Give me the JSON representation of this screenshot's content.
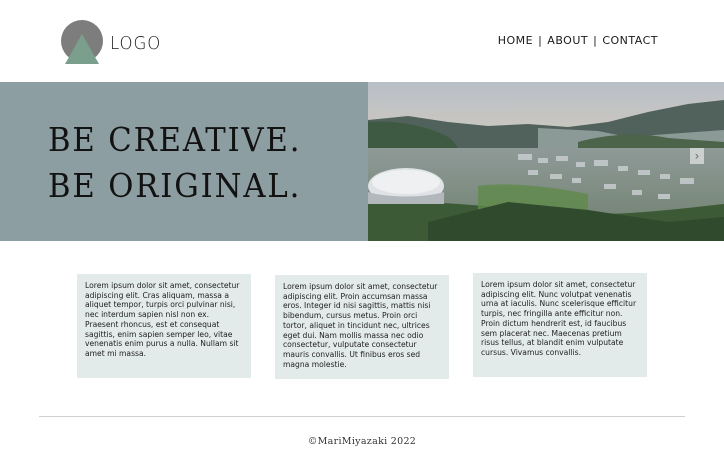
{
  "header": {
    "logo_text": "LOGO",
    "nav": [
      {
        "label": "HOME"
      },
      {
        "label": "ABOUT"
      },
      {
        "label": "CONTACT"
      }
    ],
    "separator": "|"
  },
  "hero": {
    "line1": "BE CREATIVE.",
    "line2": "BE ORIGINAL.",
    "next_arrow": "›"
  },
  "cards": [
    {
      "text": "Lorem ipsum dolor sit amet, consectetur adipiscing elit. Cras aliquam, massa a aliquet tempor, turpis orci pulvinar nisi, nec interdum sapien nisl non ex. Praesent rhoncus, est et consequat sagittis, enim sapien semper leo, vitae venenatis enim purus a nulla. Nullam sit amet mi massa."
    },
    {
      "text": "Lorem ipsum dolor sit amet, consectetur adipiscing elit. Proin accumsan massa eros. Integer id nisi sagittis, mattis nisi bibendum, cursus metus. Proin orci tortor, aliquet in tincidunt nec, ultrices eget dui. Nam mollis massa nec odio consectetur, vulputate consectetur mauris convallis. Ut finibus eros sed magna molestie."
    },
    {
      "text": "Lorem ipsum dolor sit amet, consectetur adipiscing elit. Nunc volutpat venenatis urna at iaculis. Nunc scelerisque efficitur turpis, nec fringilla ante efficitur non. Proin dictum hendrerit est, id faucibus sem placerat nec. Maecenas pretium risus tellus, at blandit enim vulputate cursus. Vivamus convallis."
    }
  ],
  "footer": {
    "text": "©MariMiyazaki 2022"
  },
  "colors": {
    "hero_panel": "#8d9ea2",
    "card_bg": "#e3ebea",
    "logo_circle": "#7d7d7d",
    "logo_triangle": "#7aa08d"
  }
}
